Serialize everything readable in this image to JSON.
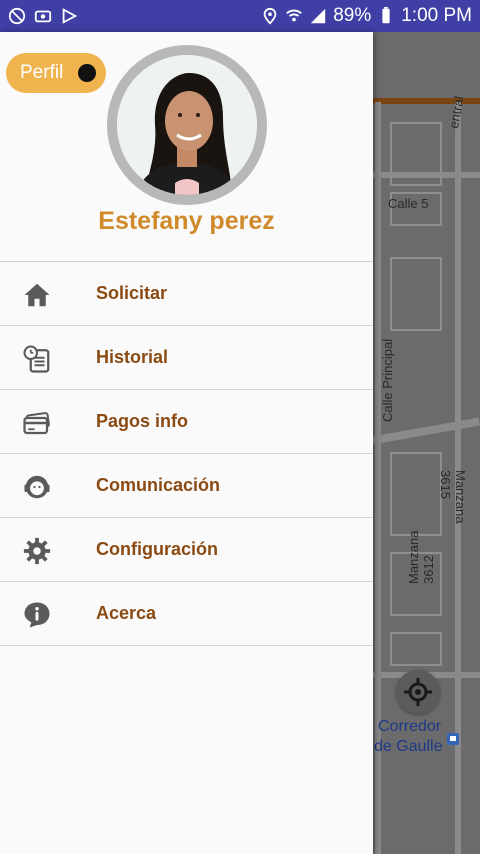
{
  "status_bar": {
    "battery_text": "89%",
    "time": "1:00 PM",
    "icons": [
      "do-not-disturb-icon",
      "screenshot-icon",
      "play-store-icon",
      "location-icon",
      "wifi-icon",
      "signal-icon",
      "battery-icon"
    ]
  },
  "drawer": {
    "profile_pill_label": "Perfil",
    "user_name": "Estefany perez",
    "menu": [
      {
        "label": "Solicitar",
        "icon": "home-icon"
      },
      {
        "label": "Historial",
        "icon": "history-icon"
      },
      {
        "label": "Pagos info",
        "icon": "payment-card-icon"
      },
      {
        "label": "Comunicación",
        "icon": "support-agent-icon"
      },
      {
        "label": "Configuración",
        "icon": "gear-icon"
      },
      {
        "label": "Acerca",
        "icon": "info-icon"
      }
    ],
    "colors": {
      "accent": "#f0b44f",
      "name_color": "#d08a2b",
      "label_color": "#8a4a12"
    }
  },
  "map": {
    "labels": [
      "entral",
      "Calle 5",
      "Calle Principal",
      "Manzana 3612",
      "Manzana 3615"
    ],
    "poi": [
      "Corredor",
      "de Gaulle"
    ]
  }
}
